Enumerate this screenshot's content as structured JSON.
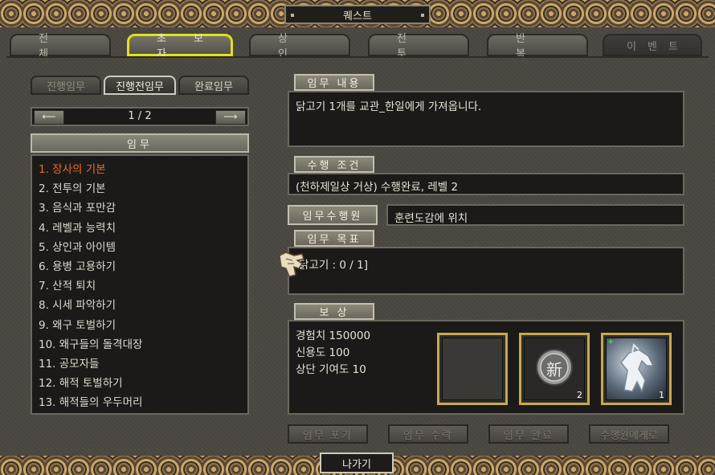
{
  "window": {
    "title": "퀘스트"
  },
  "category_tabs": [
    {
      "label": "전체",
      "state": "normal"
    },
    {
      "label": "초보자",
      "state": "active"
    },
    {
      "label": "상인",
      "state": "normal"
    },
    {
      "label": "전투",
      "state": "normal"
    },
    {
      "label": "반복",
      "state": "normal"
    },
    {
      "label": "이벤트",
      "state": "disabled"
    }
  ],
  "sub_tabs": [
    {
      "label": "진행임무",
      "state": "disabled"
    },
    {
      "label": "진행전임무",
      "state": "active"
    },
    {
      "label": "완료임무",
      "state": "normal"
    }
  ],
  "pager": {
    "text": "1 / 2",
    "prev": "⟵",
    "next": "⟶"
  },
  "quest_list": {
    "header": "임무",
    "items": [
      "1. 장사의 기본",
      "2. 전투의 기본",
      "3. 음식과 포만감",
      "4. 레벨과 능력치",
      "5. 상인과 아이템",
      "6. 용병 고용하기",
      "7. 산적 퇴치",
      "8. 시세 파악하기",
      "9. 왜구 토벌하기",
      "10. 왜구들의 돌격대장",
      "11. 공모자들",
      "12. 해적 토벌하기",
      "13. 해적들의 우두머리"
    ],
    "selected_index": 0
  },
  "detail": {
    "content_label": "임무 내용",
    "content_text": "닭고기 1개를 교관_한일에게 가져옵니다.",
    "condition_label": "수행 조건",
    "condition_text": "(천하제일상 거상) 수행완료, 레벨 2",
    "performer_label": "임무수행원",
    "performer_text": "훈련도감에 위치",
    "goal_label": "임무 목표",
    "goal_text": "닭고기 : 0 / 1]",
    "reward_label": "보 상",
    "reward_lines": [
      "경험치 150000",
      "신용도 100",
      "상단 기여도 10"
    ],
    "reward_slots": [
      {
        "icon": "empty-slot",
        "count": ""
      },
      {
        "icon": "silver-coin-icon",
        "glyph": "新",
        "count": "2"
      },
      {
        "icon": "white-horse-icon",
        "count": "1"
      }
    ]
  },
  "actions": [
    "임무 포기",
    "임무 수락",
    "임무 완료",
    "수행원에게로"
  ],
  "exit_label": "나가기",
  "colors": {
    "active_tab_border": "#e1e21a",
    "selected_item": "#f06a2a",
    "slot_border": "#c9a94e"
  }
}
